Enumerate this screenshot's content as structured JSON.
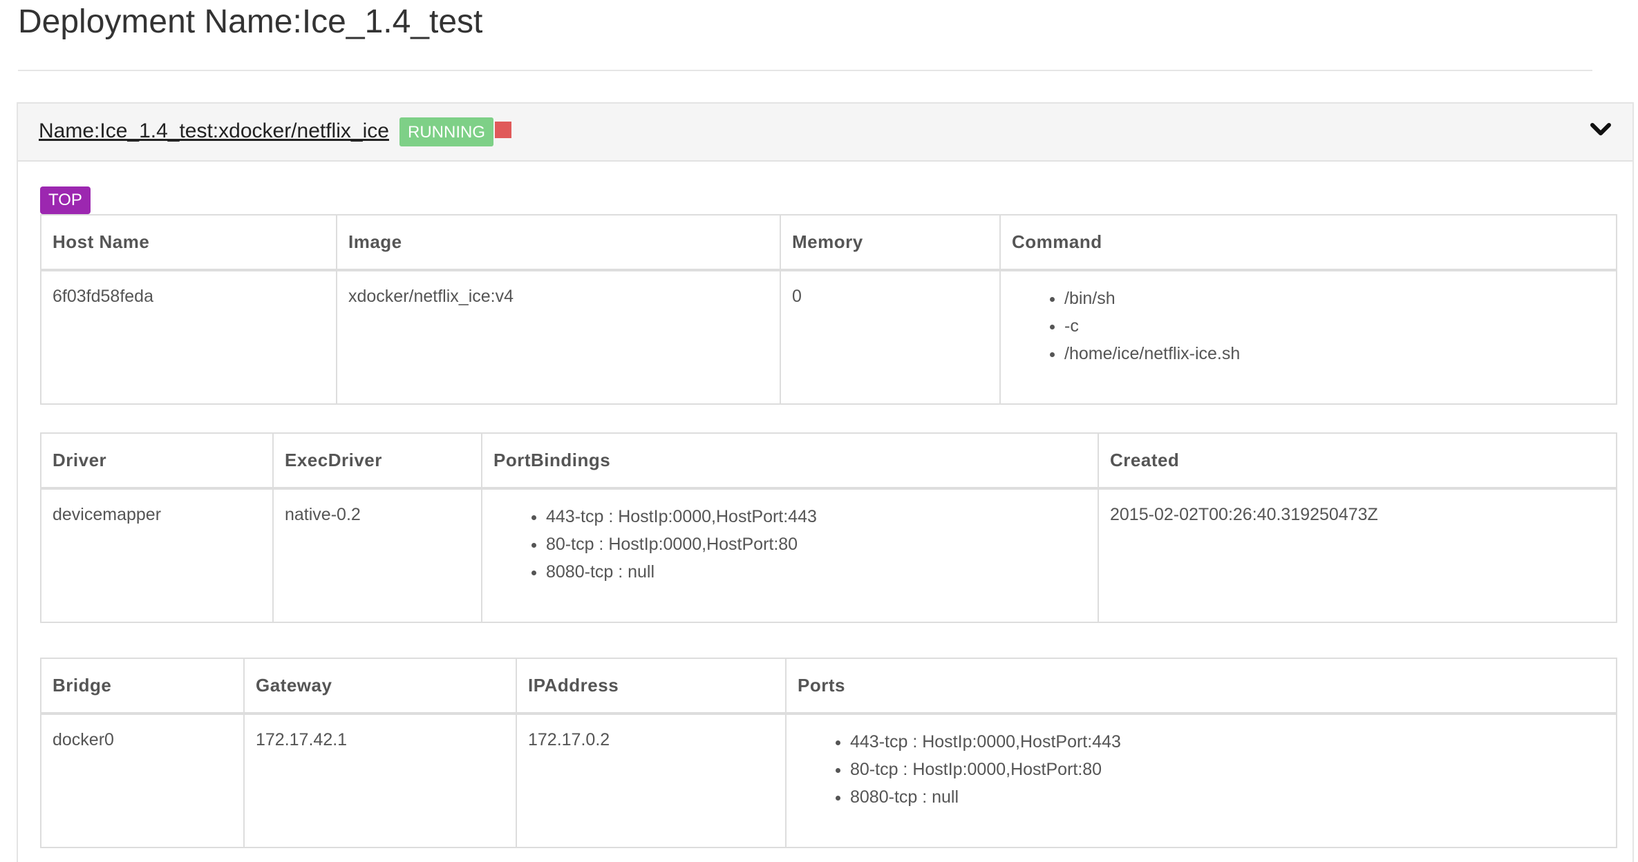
{
  "page": {
    "title": "Deployment Name:Ice_1.4_test"
  },
  "panel": {
    "name": "Name:Ice_1.4_test:xdocker/netflix_ice",
    "status": "RUNNING",
    "status_color": "#7ed087",
    "stop_icon": "stop-square-icon",
    "stop_color": "#e05a5a",
    "toggle_icon": "chevron-down-icon",
    "top_button": "TOP",
    "top_button_color": "#9c27b0"
  },
  "table1": {
    "headers": [
      "Host Name",
      "Image",
      "Memory",
      "Command"
    ],
    "host_name": "6f03fd58feda",
    "image": "xdocker/netflix_ice:v4",
    "memory": "0",
    "command": [
      "/bin/sh",
      "-c",
      "/home/ice/netflix-ice.sh"
    ]
  },
  "table2": {
    "headers": [
      "Driver",
      "ExecDriver",
      "PortBindings",
      "Created"
    ],
    "driver": "devicemapper",
    "exec_driver": "native-0.2",
    "port_bindings": [
      "443-tcp : HostIp:0000,HostPort:443",
      "80-tcp : HostIp:0000,HostPort:80",
      "8080-tcp : null"
    ],
    "created": "2015-02-02T00:26:40.319250473Z"
  },
  "table3": {
    "headers": [
      "Bridge",
      "Gateway",
      "IPAddress",
      "Ports"
    ],
    "bridge": "docker0",
    "gateway": "172.17.42.1",
    "ip_address": "172.17.0.2",
    "ports": [
      "443-tcp : HostIp:0000,HostPort:443",
      "80-tcp : HostIp:0000,HostPort:80",
      "8080-tcp : null"
    ]
  }
}
